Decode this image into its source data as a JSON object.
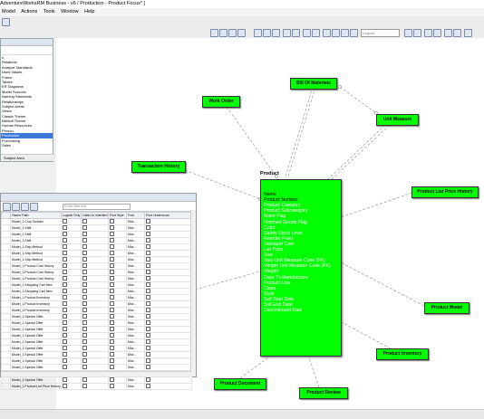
{
  "window": {
    "title": "AdventureWorksRM Business - v6 / Production - Product Focus* ]"
  },
  "menu": [
    "Model",
    "Actions",
    "Tools",
    "Window",
    "Help"
  ],
  "toolbar": {
    "search_placeholder": "Logical"
  },
  "explorer": {
    "items": [
      "s",
      "Relations",
      "Analyze Standards",
      "Used Values",
      "Frame",
      "Tables",
      "ER Diagrams",
      "Model Sources",
      "Naming Standards",
      "Relationships",
      "Subject Areas",
      "Views",
      "Classic Theme",
      "Default Theme",
      "Human Resources",
      "Person",
      "Production",
      "Purchasing",
      "Sales"
    ],
    "selected": "Production",
    "tab": "Subject Area"
  },
  "grid": {
    "filter_placeholder": "Enter filter text",
    "columns": [
      "",
      "Owner Path",
      "Logical Only",
      "Caller Is Inherited",
      "Font Style",
      "Font",
      "Font Underscore"
    ],
    "rows": [
      [
        "Model_1.Crop Sustain",
        "Micr..."
      ],
      [
        "Model_1.Shift",
        "Micr..."
      ],
      [
        "Model_1.Shift",
        "Micr..."
      ],
      [
        "Model_1.Shift",
        "Micr..."
      ],
      [
        "Model_1.Ship Method",
        "Micr..."
      ],
      [
        "Model_1.Ship Method",
        "Micr..."
      ],
      [
        "Model_1.Ship Method",
        "Micr..."
      ],
      [
        "Model_1.Product Cost History",
        "Micr..."
      ],
      [
        "Model_1.Product Cost History",
        "Micr..."
      ],
      [
        "Model_1.Product Cost History",
        "Micr..."
      ],
      [
        "Model_1.Shopping Cart Item",
        "Micr..."
      ],
      [
        "Model_1.Shopping Cart Item",
        "Micr..."
      ],
      [
        "Model_1.Product Inventory",
        "Micr..."
      ],
      [
        "Model_1.Product Inventory",
        "Micr..."
      ],
      [
        "Model_1.Product Inventory",
        "Micr..."
      ],
      [
        "Model_1.Special Offer",
        "Micr..."
      ],
      [
        "Model_1.Special Offer",
        "Micr..."
      ],
      [
        "Model_1.Special Offer",
        "Micr..."
      ],
      [
        "Model_1.Special Offer",
        "Micr..."
      ],
      [
        "Model_1.Special Offer",
        "Micr..."
      ],
      [
        "Model_1.Special Offer",
        "Micr..."
      ],
      [
        "Model_1.Special Offer",
        "Micr..."
      ],
      [
        "Model_1.Special Offer",
        "Micr..."
      ],
      [
        "Model_1.Special Offer",
        "Micr..."
      ],
      [
        "Model_1.Special Offer",
        "Micr..."
      ],
      [
        "Model_1.Special Offer",
        "Micr..."
      ],
      [
        "Model_1.Product List Price History",
        "Micr..."
      ]
    ]
  },
  "diagram": {
    "product_title": "Product",
    "product_attributes": [
      "Name",
      "Product Number",
      "Product Category",
      "Product Subcategory",
      "Make Flag",
      "Finished Goods Flag",
      "Color",
      "Safety Stock Level",
      "Reorder Point",
      "Standard Cost",
      "List Price",
      "Size",
      "Size Unit Measure Code (FK)",
      "Weight Unit Measure Code (FK)",
      "Weight",
      "Days To Manufacture",
      "Product Line",
      "Class",
      "Style",
      "Sell Start Date",
      "Sell End Date",
      "Discontinued Date"
    ],
    "entities": [
      "Work Order",
      "Bill Of Materials",
      "Unit Measure",
      "Transaction History",
      "Product List Price History",
      "Product Model",
      "Product Inventory",
      "Product Document",
      "Product Review"
    ],
    "entity_color": "#00ff00"
  }
}
